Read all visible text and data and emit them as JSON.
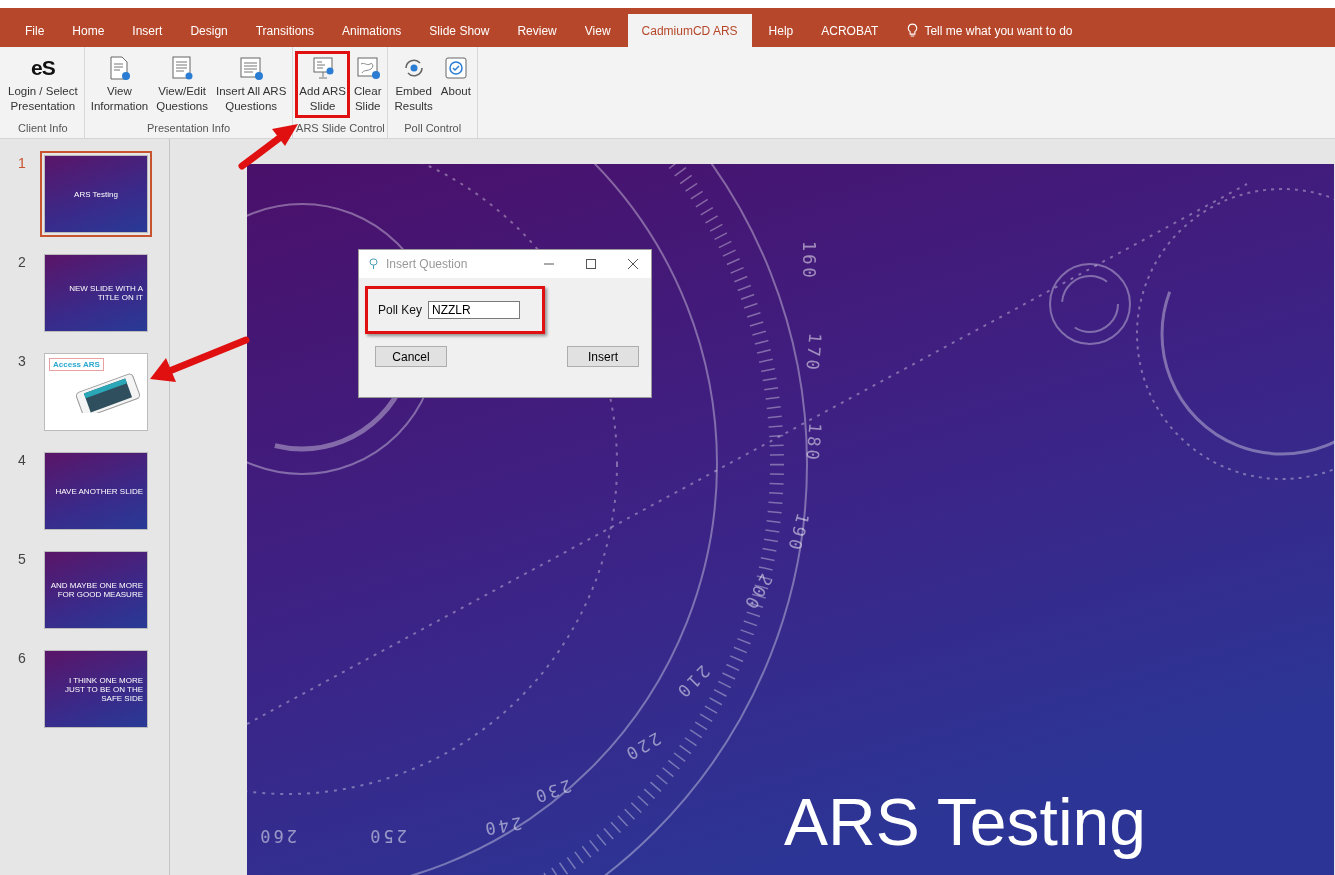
{
  "ribbon": {
    "tabs": [
      {
        "label": "File",
        "selected": false
      },
      {
        "label": "Home",
        "selected": false
      },
      {
        "label": "Insert",
        "selected": false
      },
      {
        "label": "Design",
        "selected": false
      },
      {
        "label": "Transitions",
        "selected": false
      },
      {
        "label": "Animations",
        "selected": false
      },
      {
        "label": "Slide Show",
        "selected": false
      },
      {
        "label": "Review",
        "selected": false
      },
      {
        "label": "View",
        "selected": false
      },
      {
        "label": "CadmiumCD ARS",
        "selected": true
      },
      {
        "label": "Help",
        "selected": false
      },
      {
        "label": "ACROBAT",
        "selected": false
      }
    ],
    "tell_me": {
      "placeholder": "Tell me what you want to do"
    },
    "groups": [
      {
        "label": "Client Info",
        "buttons": [
          {
            "label": "Login / Select\nPresentation",
            "logo": "eS",
            "highlighted": false
          }
        ]
      },
      {
        "label": "Presentation Info",
        "buttons": [
          {
            "label": "View\nInformation",
            "highlighted": false
          },
          {
            "label": "View/Edit\nQuestions",
            "highlighted": false
          },
          {
            "label": "Insert All ARS\nQuestions",
            "highlighted": false
          }
        ]
      },
      {
        "label": "ARS Slide Control",
        "buttons": [
          {
            "label": "Add ARS\nSlide",
            "highlighted": true
          },
          {
            "label": "Clear\nSlide",
            "highlighted": false
          }
        ]
      },
      {
        "label": "Poll Control",
        "buttons": [
          {
            "label": "Embed\nResults",
            "highlighted": false
          },
          {
            "label": "About",
            "highlighted": false
          }
        ]
      }
    ]
  },
  "slides": [
    {
      "number": "1",
      "selected": true,
      "kind": "title",
      "title": "ARS Testing"
    },
    {
      "number": "2",
      "selected": false,
      "kind": "title",
      "title": "NEW SLIDE WITH A TITLE ON IT"
    },
    {
      "number": "3",
      "selected": false,
      "kind": "image",
      "title": "Access ARS"
    },
    {
      "number": "4",
      "selected": false,
      "kind": "title",
      "title": "HAVE ANOTHER SLIDE"
    },
    {
      "number": "5",
      "selected": false,
      "kind": "title",
      "title": "AND MAYBE ONE MORE FOR GOOD MEASURE"
    },
    {
      "number": "6",
      "selected": false,
      "kind": "title",
      "title": "I THINK ONE MORE JUST TO BE ON THE SAFE SIDE"
    }
  ],
  "slide": {
    "title": "ARS Testing",
    "dial_numbers": [
      "160",
      "170",
      "180",
      "190",
      "200",
      "210",
      "220",
      "230",
      "240",
      "250",
      "260"
    ]
  },
  "dialog": {
    "title": "Insert Question",
    "poll_key": {
      "label": "Poll Key",
      "value": "NZZLR",
      "highlighted": true
    },
    "buttons": [
      "Cancel",
      "Insert"
    ]
  }
}
